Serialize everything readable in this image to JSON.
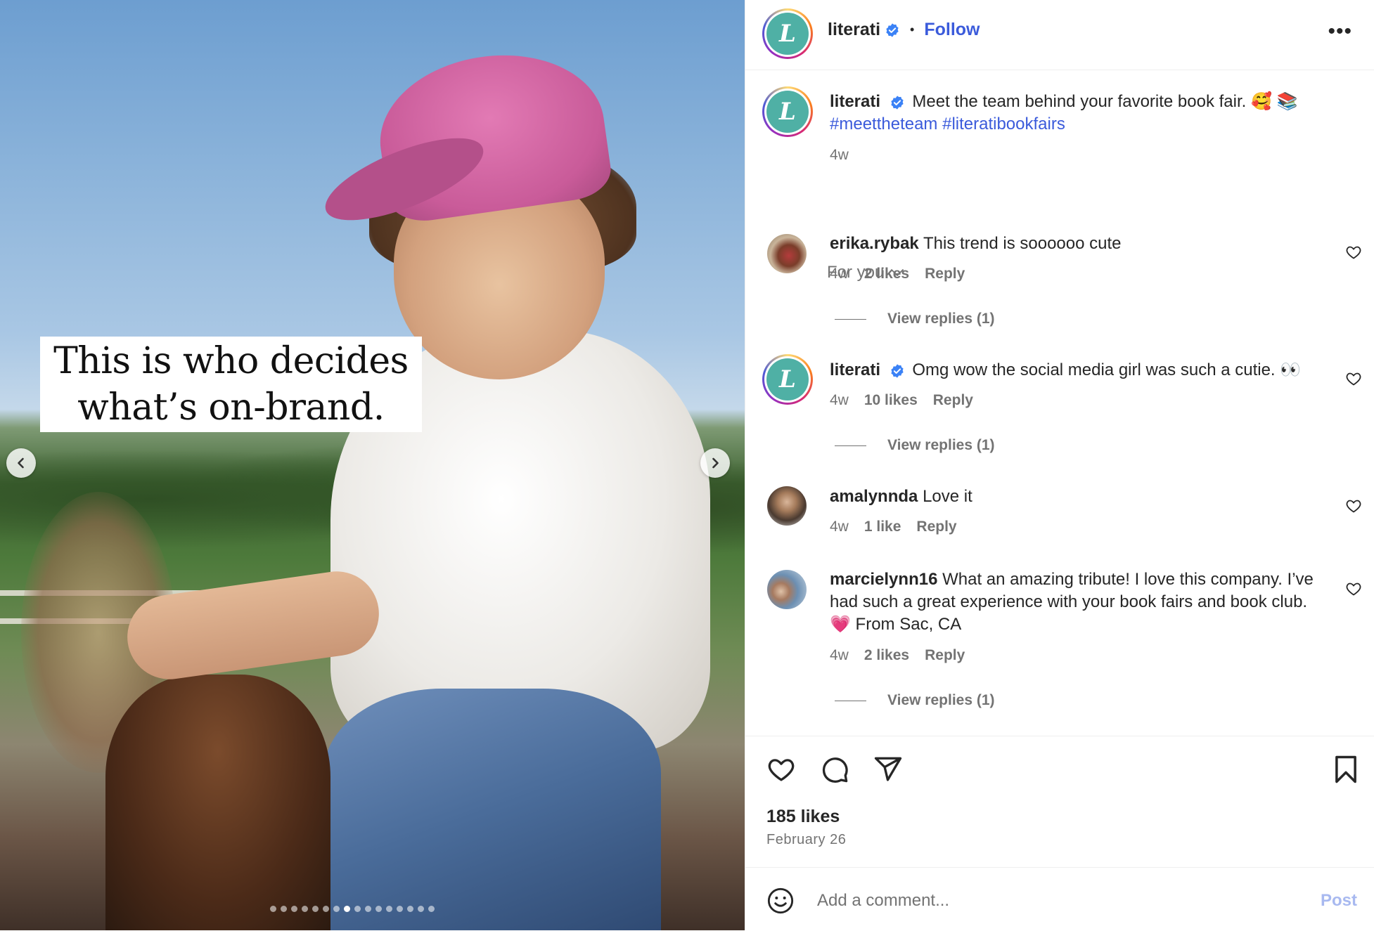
{
  "media": {
    "overlay_line1": "This is who decides",
    "overlay_line2": "what’s on-brand.",
    "prev_icon": "chevron-left-icon",
    "next_icon": "chevron-right-icon",
    "slide_count": 16,
    "active_slide": 7
  },
  "header": {
    "username": "literati",
    "separator": "•",
    "follow_label": "Follow",
    "avatar_letter": "L",
    "more_label": "•••"
  },
  "caption": {
    "username": "literati",
    "text": "Meet the team behind your favorite book fair. 🥰 📚",
    "hashtags": "#meettheteam #literatibookfairs",
    "age": "4w"
  },
  "filter": {
    "label": "For you"
  },
  "comments": [
    {
      "username": "erika.rybak",
      "text": "This trend is soooooo cute",
      "age": "4w",
      "likes": "2 likes",
      "reply": "Reply",
      "view_replies": "View replies (1)"
    },
    {
      "username": "literati",
      "text": "Omg wow the social media girl was such a cutie. 👀",
      "age": "4w",
      "likes": "10 likes",
      "reply": "Reply",
      "view_replies": "View replies (1)"
    },
    {
      "username": "amalynnda",
      "text": "Love it",
      "age": "4w",
      "likes": "1 like",
      "reply": "Reply"
    },
    {
      "username": "marcielynn16",
      "text": "What an amazing tribute! I love this company. I’ve had such a great experience with your book fairs and book club. 💗 From Sac, CA",
      "age": "4w",
      "likes": "2 likes",
      "reply": "Reply",
      "view_replies": "View replies (1)"
    }
  ],
  "actions": {
    "likes": "185 likes",
    "date": "February 26"
  },
  "add_comment": {
    "placeholder": "Add a comment...",
    "post_label": "Post"
  },
  "colors": {
    "link": "#3b5bdb",
    "brand_teal": "#4fb0a5",
    "muted": "#737373"
  }
}
